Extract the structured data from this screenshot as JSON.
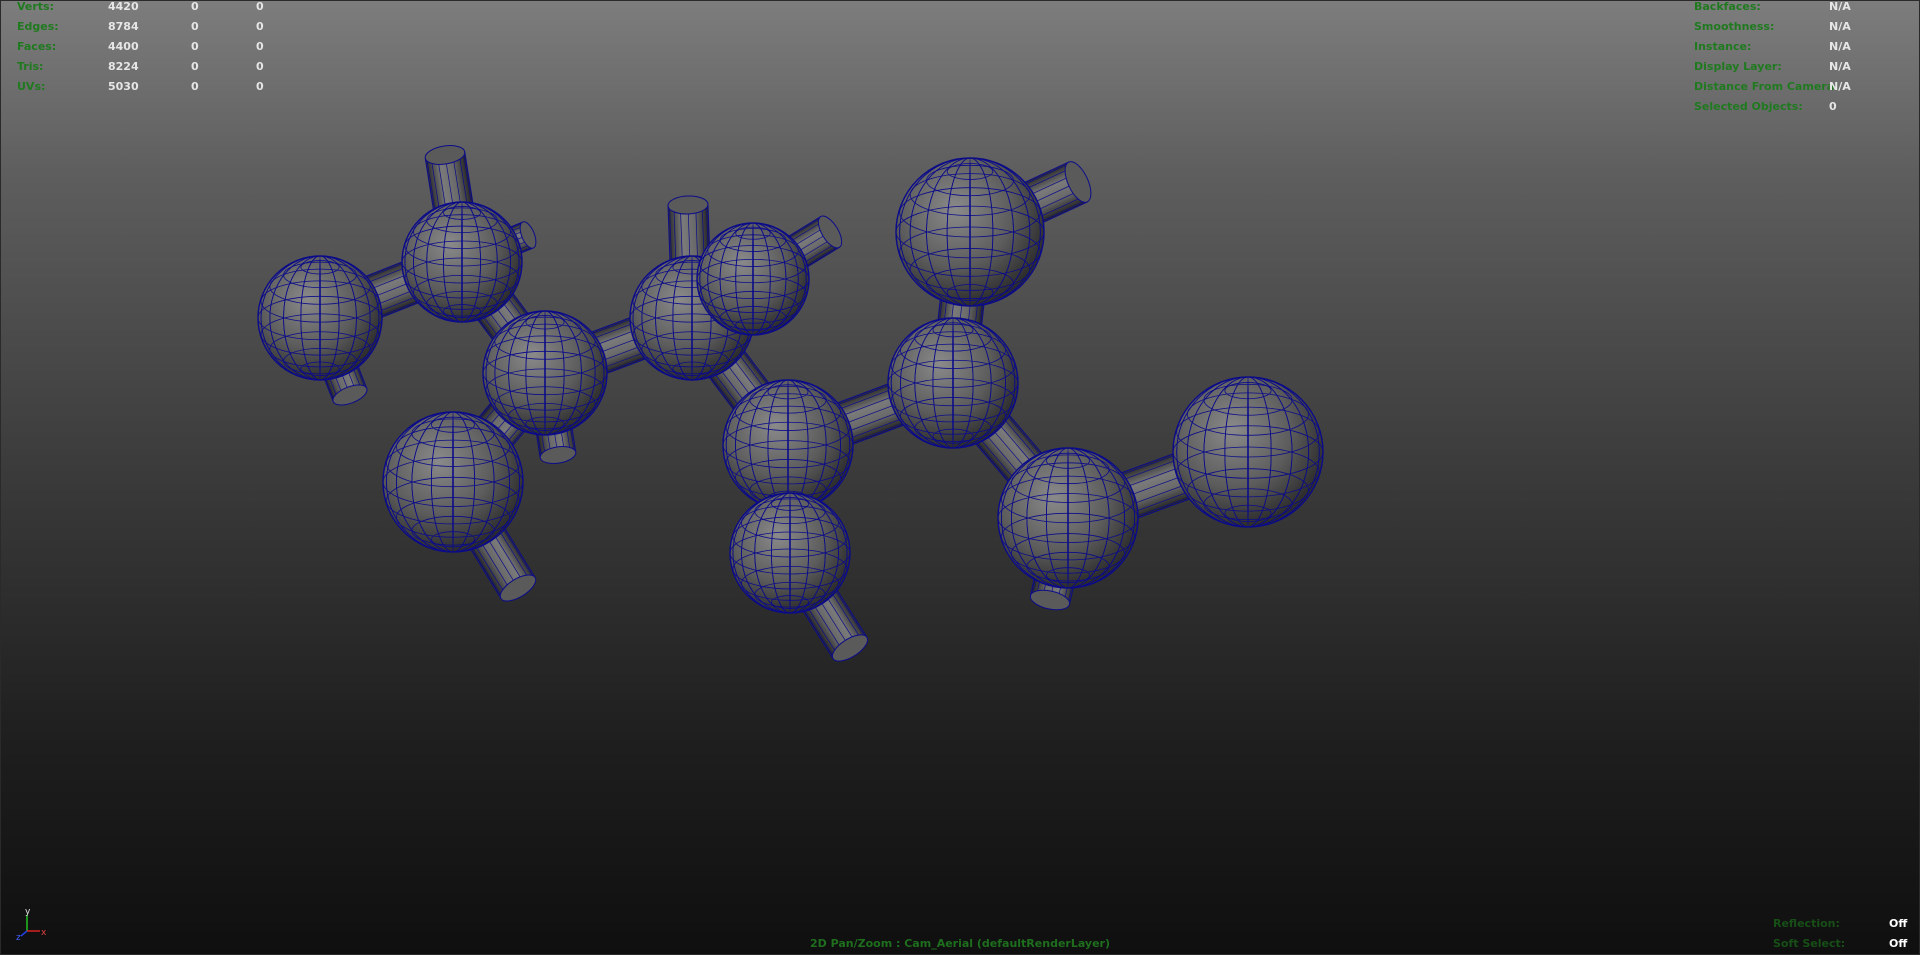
{
  "stats": {
    "rows": [
      {
        "label": "Verts:",
        "v1": "4420",
        "v2": "0",
        "v3": "0"
      },
      {
        "label": "Edges:",
        "v1": "8784",
        "v2": "0",
        "v3": "0"
      },
      {
        "label": "Faces:",
        "v1": "4400",
        "v2": "0",
        "v3": "0"
      },
      {
        "label": "Tris:",
        "v1": "8224",
        "v2": "0",
        "v3": "0"
      },
      {
        "label": "UVs:",
        "v1": "5030",
        "v2": "0",
        "v3": "0"
      }
    ]
  },
  "object_info": {
    "rows": [
      {
        "label": "Backfaces:",
        "value": "N/A"
      },
      {
        "label": "Smoothness:",
        "value": "N/A"
      },
      {
        "label": "Instance:",
        "value": "N/A"
      },
      {
        "label": "Display Layer:",
        "value": "N/A"
      },
      {
        "label": "Distance From Camera:",
        "value": "N/A"
      },
      {
        "label": "Selected Objects:",
        "value": "0"
      }
    ]
  },
  "status": {
    "reflection_label": "Reflection:",
    "reflection_value": "Off",
    "soft_select_label": "Soft Select:",
    "soft_select_value": "Off"
  },
  "camera_label": "2D Pan/Zoom : Cam_Aerial (defaultRenderLayer)",
  "axis": {
    "y": "y",
    "z": "z",
    "x": "x"
  },
  "colors": {
    "wireframe": "#0c0c8a",
    "surface": "#5a5a5a",
    "hud_label": "#1f7a1f",
    "axis_x": "#d62020",
    "axis_y": "#20c020",
    "axis_z": "#2040e0"
  }
}
